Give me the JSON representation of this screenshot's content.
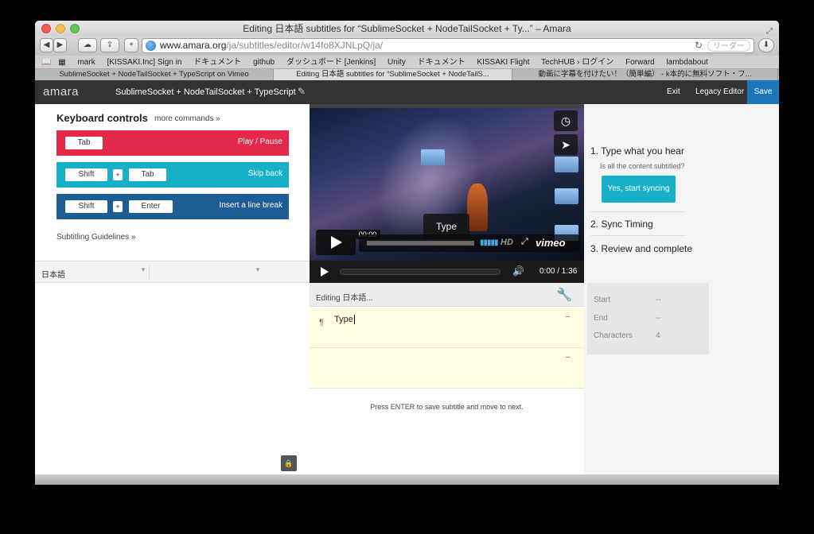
{
  "window": {
    "title": "Editing 日本語 subtitles for “SublimeSocket + NodeTailSocket + Ty...” – Amara"
  },
  "toolbar": {
    "url_host": "www.amara.org",
    "url_path": "/ja/subtitles/editor/w14fo8XJNLpQ/ja/",
    "reader_label": "リーダー",
    "add_label": "+"
  },
  "bookmarks": [
    "mark",
    "[KISSAKI.Inc] Sign in",
    "ドキュメント",
    "github",
    "ダッシュボード [Jenkins]",
    "Unity",
    "ドキュメント",
    "KISSAKI Flight",
    "TechHUB › ログイン",
    "Forward",
    "lambdabout"
  ],
  "tabs": [
    "SublimeSocket + NodeTailSocket + TypeScript on Vimeo",
    "Editing 日本語 subtitles for “SublimeSocket + NodeTailS...",
    "動画に字幕を付けたい！（簡単編） - k本的に無料ソフト・フ..."
  ],
  "nav": {
    "logo": "amara",
    "video_title": "SublimeSocket + NodeTailSocket + TypeScript",
    "exit": "Exit",
    "legacy": "Legacy Editor",
    "save": "Save"
  },
  "keyboard": {
    "title": "Keyboard controls",
    "more": "more commands »",
    "rows": [
      {
        "keys": [
          "Tab"
        ],
        "action": "Play / Pause",
        "color": "#e4294a"
      },
      {
        "keys": [
          "Shift",
          "+",
          "Tab"
        ],
        "action": "Skip back",
        "color": "#17b0c6"
      },
      {
        "keys": [
          "Shift",
          "+",
          "Enter"
        ],
        "action": "Insert a line break",
        "color": "#1f5d97"
      }
    ],
    "guidelines": "Subtitling Guidelines »"
  },
  "language": {
    "selected": "日本語"
  },
  "video": {
    "type_tip": "Type",
    "time_tip": "00:00",
    "hd": "HD",
    "brand": "vimeo",
    "time": "0:00 / 1:36"
  },
  "editor": {
    "editing_label": "Editing 日本語...",
    "subtitles": [
      {
        "text": "Type",
        "dash": "–"
      },
      {
        "text": "",
        "dash": "–"
      }
    ],
    "hint": "Press ENTER to save subtitle and move to next."
  },
  "steps": {
    "step1": "1. Type what you hear",
    "question": "Is all the content subtitled?",
    "sync_button": "Yes, start syncing",
    "step2": "2. Sync Timing",
    "step3": "3. Review and complete"
  },
  "stats": [
    {
      "label": "Start",
      "value": "--"
    },
    {
      "label": "End",
      "value": "--"
    },
    {
      "label": "Characters",
      "value": "4"
    }
  ]
}
